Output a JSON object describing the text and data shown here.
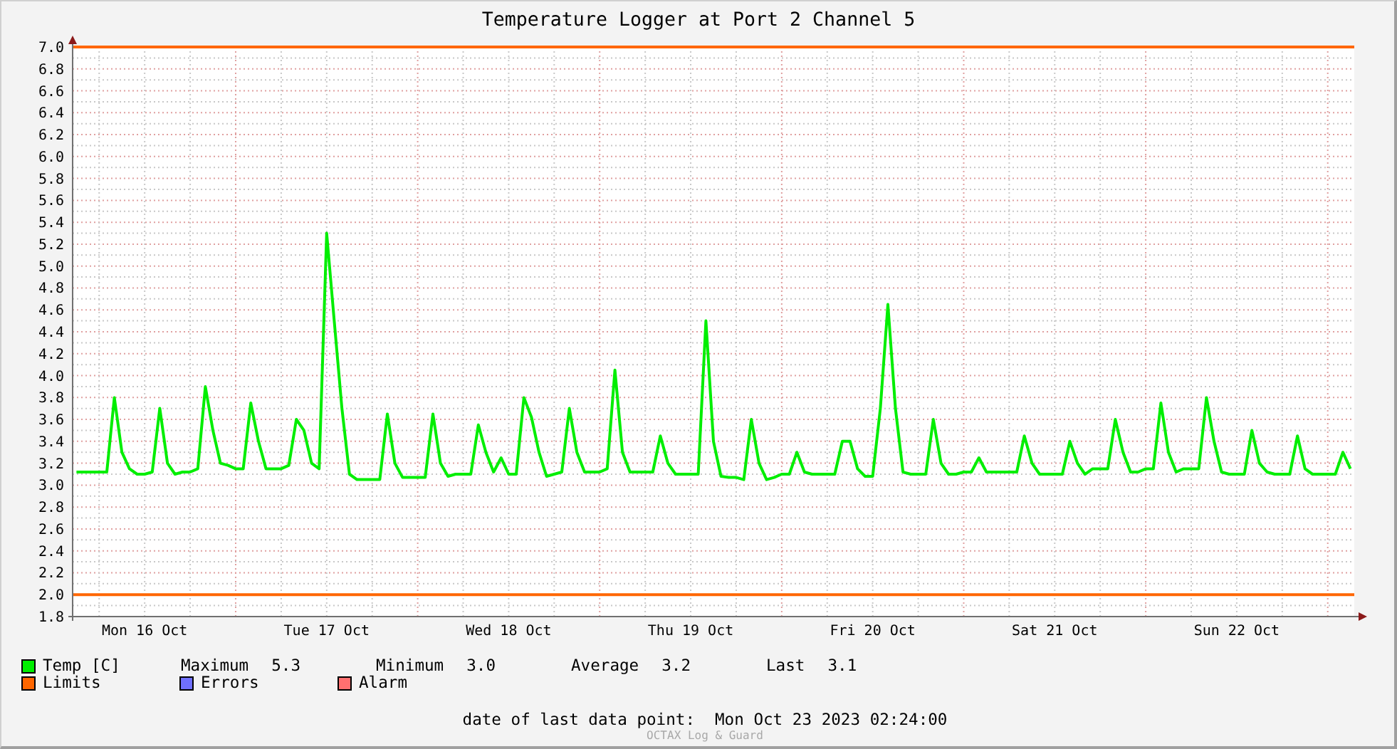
{
  "graph": {
    "chart_data": {
      "type": "line",
      "title": "Temperature Logger at Port 2 Channel 5",
      "categories": [
        null,
        null,
        null,
        null,
        null,
        null,
        null,
        null,
        null,
        "Mon 16 Oct",
        null,
        null,
        null,
        null,
        null,
        null,
        null,
        null,
        null,
        null,
        null,
        null,
        null,
        null,
        null,
        null,
        null,
        null,
        null,
        null,
        null,
        null,
        null,
        "Tue 17 Oct",
        null,
        null,
        null,
        null,
        null,
        null,
        null,
        null,
        null,
        null,
        null,
        null,
        null,
        null,
        null,
        null,
        null,
        null,
        null,
        null,
        null,
        null,
        null,
        "Wed 18 Oct",
        null,
        null,
        null,
        null,
        null,
        null,
        null,
        null,
        null,
        null,
        null,
        null,
        null,
        null,
        null,
        null,
        null,
        null,
        null,
        null,
        null,
        null,
        null,
        "Thu 19 Oct",
        null,
        null,
        null,
        null,
        null,
        null,
        null,
        null,
        null,
        null,
        null,
        null,
        null,
        null,
        null,
        null,
        null,
        null,
        null,
        null,
        null,
        null,
        null,
        "Fri 20 Oct",
        null,
        null,
        null,
        null,
        null,
        null,
        null,
        null,
        null,
        null,
        null,
        null,
        null,
        null,
        null,
        null,
        null,
        null,
        null,
        null,
        null,
        null,
        null,
        "Sat 21 Oct",
        null,
        null,
        null,
        null,
        null,
        null,
        null,
        null,
        null,
        null,
        null,
        null,
        null,
        null,
        null,
        null,
        null,
        null,
        null,
        null,
        null,
        null,
        null,
        "Sun 22 Oct",
        null,
        null,
        null,
        null,
        null,
        null,
        null,
        null,
        null,
        null,
        null,
        null,
        null,
        null,
        null
      ],
      "series": [
        {
          "name": "Temp [C]",
          "color": "#00ee00",
          "values": [
            3.12,
            3.12,
            3.12,
            3.12,
            3.12,
            3.8,
            3.3,
            3.15,
            3.1,
            3.1,
            3.12,
            3.7,
            3.2,
            3.1,
            3.12,
            3.12,
            3.15,
            3.9,
            3.5,
            3.2,
            3.18,
            3.15,
            3.15,
            3.75,
            3.4,
            3.15,
            3.15,
            3.15,
            3.18,
            3.6,
            3.5,
            3.2,
            3.15,
            5.3,
            4.5,
            3.7,
            3.1,
            3.05,
            3.05,
            3.05,
            3.05,
            3.65,
            3.2,
            3.07,
            3.07,
            3.07,
            3.07,
            3.65,
            3.2,
            3.08,
            3.1,
            3.1,
            3.1,
            3.55,
            3.3,
            3.12,
            3.25,
            3.1,
            3.1,
            3.8,
            3.62,
            3.3,
            3.08,
            3.1,
            3.12,
            3.7,
            3.3,
            3.12,
            3.12,
            3.12,
            3.15,
            4.05,
            3.3,
            3.12,
            3.12,
            3.12,
            3.12,
            3.45,
            3.2,
            3.1,
            3.1,
            3.1,
            3.1,
            4.5,
            3.4,
            3.08,
            3.07,
            3.07,
            3.05,
            3.6,
            3.2,
            3.05,
            3.07,
            3.1,
            3.1,
            3.3,
            3.12,
            3.1,
            3.1,
            3.1,
            3.1,
            3.4,
            3.4,
            3.15,
            3.08,
            3.08,
            3.7,
            4.65,
            3.7,
            3.12,
            3.1,
            3.1,
            3.1,
            3.6,
            3.2,
            3.1,
            3.1,
            3.12,
            3.12,
            3.25,
            3.12,
            3.12,
            3.12,
            3.12,
            3.12,
            3.45,
            3.2,
            3.1,
            3.1,
            3.1,
            3.1,
            3.4,
            3.2,
            3.1,
            3.15,
            3.15,
            3.15,
            3.6,
            3.3,
            3.12,
            3.12,
            3.15,
            3.15,
            3.75,
            3.3,
            3.12,
            3.15,
            3.15,
            3.15,
            3.8,
            3.4,
            3.12,
            3.1,
            3.1,
            3.1,
            3.5,
            3.2,
            3.12,
            3.1,
            3.1,
            3.1,
            3.45,
            3.15,
            3.1,
            3.1,
            3.1,
            3.1,
            3.3,
            3.15
          ]
        }
      ],
      "ylim": [
        1.8,
        7.0
      ],
      "grid": true,
      "yticks": [
        1.8,
        {
          "value": 2,
          "label": "2.0"
        },
        2.2,
        2.4,
        2.6,
        2.8,
        {
          "value": 3,
          "label": "3.0"
        },
        3.2,
        3.4,
        3.6,
        3.8,
        {
          "value": 4,
          "label": "4.0"
        },
        4.2,
        4.4,
        4.6,
        4.8,
        {
          "value": 5,
          "label": "5.0"
        },
        5.2,
        5.4,
        5.6,
        5.8,
        {
          "value": 6,
          "label": "6.0"
        },
        6.2,
        6.4,
        6.6,
        6.8,
        {
          "value": 7,
          "label": "7.0"
        }
      ],
      "ref_lines": [
        {
          "axis": "y",
          "value": 7.0,
          "color": "#ff6600"
        },
        {
          "axis": "y",
          "value": 2.0,
          "color": "#ff6600"
        }
      ]
    }
  },
  "legend": [
    {
      "label": "Limits",
      "color": "#ff6600"
    },
    {
      "label": "Errors",
      "color": "#7070ff"
    },
    {
      "label": "Alarm",
      "color": "#ff7070"
    }
  ],
  "stats": [
    {
      "label": "Maximum",
      "value": "5.3"
    },
    {
      "label": "Minimum",
      "value": "3.0"
    },
    {
      "label": "Average",
      "value": "3.2"
    },
    {
      "label": "Last",
      "value": "3.1"
    }
  ],
  "last_data_point": {
    "label": "date of last data point:",
    "value": "Mon Oct 23 2023 02:24:00"
  },
  "credit": "OCTAX Log & Guard"
}
